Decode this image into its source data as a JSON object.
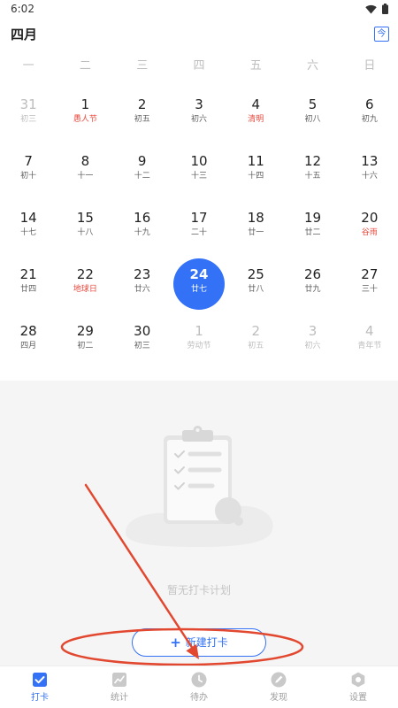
{
  "status_bar": {
    "time": "6:02",
    "icons": [
      "wifi-icon",
      "battery-icon"
    ]
  },
  "header": {
    "title": "四月",
    "today_button": "今"
  },
  "calendar": {
    "weekdays": [
      "一",
      "二",
      "三",
      "四",
      "五",
      "六",
      "日"
    ],
    "weeks": [
      [
        {
          "day": "31",
          "sub": "初三",
          "other_month": true
        },
        {
          "day": "1",
          "sub": "愚人节",
          "holiday": true
        },
        {
          "day": "2",
          "sub": "初五"
        },
        {
          "day": "3",
          "sub": "初六"
        },
        {
          "day": "4",
          "sub": "清明",
          "holiday": true
        },
        {
          "day": "5",
          "sub": "初八"
        },
        {
          "day": "6",
          "sub": "初九"
        }
      ],
      [
        {
          "day": "7",
          "sub": "初十"
        },
        {
          "day": "8",
          "sub": "十一"
        },
        {
          "day": "9",
          "sub": "十二"
        },
        {
          "day": "10",
          "sub": "十三"
        },
        {
          "day": "11",
          "sub": "十四"
        },
        {
          "day": "12",
          "sub": "十五"
        },
        {
          "day": "13",
          "sub": "十六"
        }
      ],
      [
        {
          "day": "14",
          "sub": "十七"
        },
        {
          "day": "15",
          "sub": "十八"
        },
        {
          "day": "16",
          "sub": "十九"
        },
        {
          "day": "17",
          "sub": "二十"
        },
        {
          "day": "18",
          "sub": "廿一"
        },
        {
          "day": "19",
          "sub": "廿二"
        },
        {
          "day": "20",
          "sub": "谷雨",
          "holiday": true
        }
      ],
      [
        {
          "day": "21",
          "sub": "廿四"
        },
        {
          "day": "22",
          "sub": "地球日",
          "holiday": true
        },
        {
          "day": "23",
          "sub": "廿六"
        },
        {
          "day": "24",
          "sub": "廿七",
          "selected": true
        },
        {
          "day": "25",
          "sub": "廿八"
        },
        {
          "day": "26",
          "sub": "廿九"
        },
        {
          "day": "27",
          "sub": "三十"
        }
      ],
      [
        {
          "day": "28",
          "sub": "四月"
        },
        {
          "day": "29",
          "sub": "初二"
        },
        {
          "day": "30",
          "sub": "初三"
        },
        {
          "day": "1",
          "sub": "劳动节",
          "other_month": true
        },
        {
          "day": "2",
          "sub": "初五",
          "other_month": true
        },
        {
          "day": "3",
          "sub": "初六",
          "other_month": true
        },
        {
          "day": "4",
          "sub": "青年节",
          "other_month": true
        }
      ]
    ]
  },
  "empty_state": {
    "illustration": "clipboard-checklist-illustration",
    "message": "暂无打卡计划"
  },
  "new_button": {
    "plus": "+",
    "label": "新建打卡"
  },
  "tab_bar": {
    "tabs": [
      {
        "label": "打卡",
        "icon": "check-square-icon",
        "active": true
      },
      {
        "label": "统计",
        "icon": "line-chart-icon"
      },
      {
        "label": "待办",
        "icon": "clock-icon"
      },
      {
        "label": "发现",
        "icon": "pencil-icon"
      },
      {
        "label": "设置",
        "icon": "settings-hexagon-icon"
      }
    ]
  },
  "colors": {
    "primary": "#3371f6",
    "holiday": "#e9493e",
    "muted_text": "#bdbdbd",
    "panel_background": "#f5f5f5",
    "annotation": "#e2472f"
  }
}
